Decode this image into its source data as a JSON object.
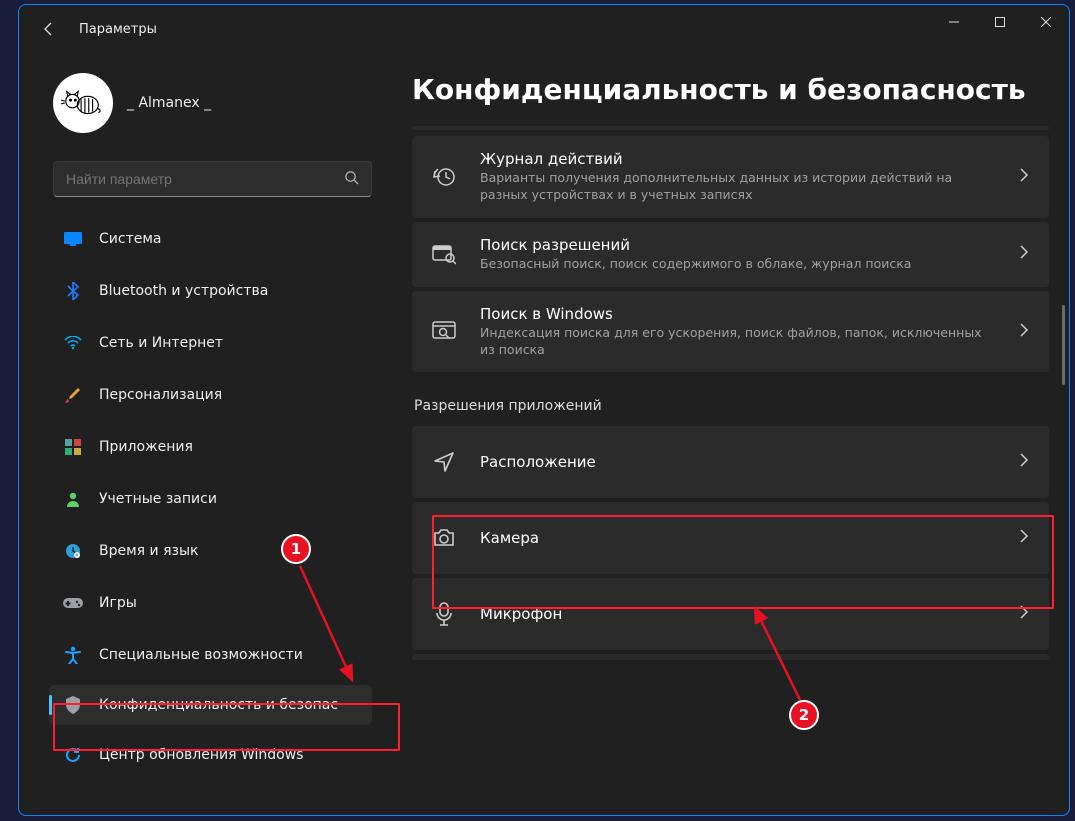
{
  "window_title": "Параметры",
  "user": {
    "name": "_ Almanex _"
  },
  "search": {
    "placeholder": "Найти параметр"
  },
  "sidebar": {
    "items": [
      {
        "label": "Система",
        "icon": "system",
        "color": "#0a84ff"
      },
      {
        "label": "Bluetooth и устройства",
        "icon": "bluetooth",
        "color": "#1e7bff"
      },
      {
        "label": "Сеть и Интернет",
        "icon": "wifi",
        "color": "#00b0f0"
      },
      {
        "label": "Персонализация",
        "icon": "brush",
        "color": "#e8a33d"
      },
      {
        "label": "Приложения",
        "icon": "apps",
        "color": "#5aa0a0"
      },
      {
        "label": "Учетные записи",
        "icon": "user",
        "color": "#5bd06b"
      },
      {
        "label": "Время и язык",
        "icon": "clock",
        "color": "#2e9cd6"
      },
      {
        "label": "Игры",
        "icon": "gamepad",
        "color": "#9aa0a6"
      },
      {
        "label": "Специальные возможности",
        "icon": "access",
        "color": "#1fa1ff"
      },
      {
        "label": "Конфиденциальность и безопас",
        "icon": "shield",
        "color": "#9aa0a6",
        "active": true
      },
      {
        "label": "Центр обновления Windows",
        "icon": "refresh",
        "color": "#1fa1ff"
      }
    ]
  },
  "page": {
    "title": "Конфиденциальность и безопасность",
    "section_header": "Разрешения приложений",
    "cards_top": [
      {
        "icon": "history",
        "title": "Журнал действий",
        "sub": "Варианты получения дополнительных данных из истории действий на разных устройствах и в учетных записях"
      },
      {
        "icon": "permsearch",
        "title": "Поиск разрешений",
        "sub": "Безопасный поиск, поиск содержимого в облаке, журнал поиска"
      },
      {
        "icon": "winsearch",
        "title": "Поиск в Windows",
        "sub": "Индексация поиска для его ускорения, поиск файлов, папок, исключенных из поиска"
      }
    ],
    "cards_perm": [
      {
        "icon": "location",
        "title": "Расположение"
      },
      {
        "icon": "camera",
        "title": "Камера"
      },
      {
        "icon": "mic",
        "title": "Микрофон"
      }
    ]
  },
  "annotations": {
    "badge1": "1",
    "badge2": "2",
    "highlight_color": "#ff1f2f"
  }
}
